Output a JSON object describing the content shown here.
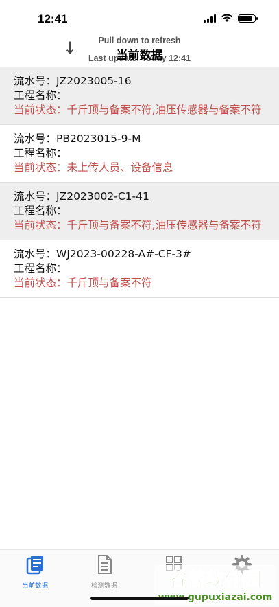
{
  "status_bar": {
    "time": "12:41",
    "battery_level": 0.85
  },
  "refresh": {
    "arrow": "↓",
    "line1": "Pull down to refresh",
    "line2": "Last update: Today 12:41"
  },
  "nav": {
    "title": "当前数据"
  },
  "records": [
    {
      "serial_label": "流水号：",
      "serial": "JZ2023005-16",
      "project_label": "工程名称：",
      "project": "",
      "status_label": "当前状态：",
      "status": "千斤顶与备案不符,油压传感器与备案不符"
    },
    {
      "serial_label": "流水号：",
      "serial": "PB2023015-9-M",
      "project_label": "工程名称：",
      "project": "",
      "status_label": "当前状态：",
      "status": "未上传人员、设备信息"
    },
    {
      "serial_label": "流水号：",
      "serial": "JZ2023002-C1-41",
      "project_label": "工程名称：",
      "project": "",
      "status_label": "当前状态：",
      "status": "千斤顶与备案不符,油压传感器与备案不符"
    },
    {
      "serial_label": "流水号：",
      "serial": "WJ2023-00228-A#-CF-3#",
      "project_label": "工程名称：",
      "project": "",
      "status_label": "当前状态：",
      "status": "千斤顶与备案不符"
    }
  ],
  "tabs": [
    {
      "label": "当前数据",
      "icon": "list-document-icon",
      "active": true
    },
    {
      "label": "检测数据",
      "icon": "document-icon",
      "active": false
    },
    {
      "label": "",
      "icon": "grid-icon",
      "active": false
    },
    {
      "label": "",
      "icon": "gear-icon",
      "active": false
    }
  ],
  "watermark": {
    "line1": "谷普软件园",
    "line2": "www.gupuxiazai.com"
  },
  "colors": {
    "accent": "#2a6fd6",
    "status_text": "#c0504d",
    "alt_row": "#eeeeee"
  }
}
